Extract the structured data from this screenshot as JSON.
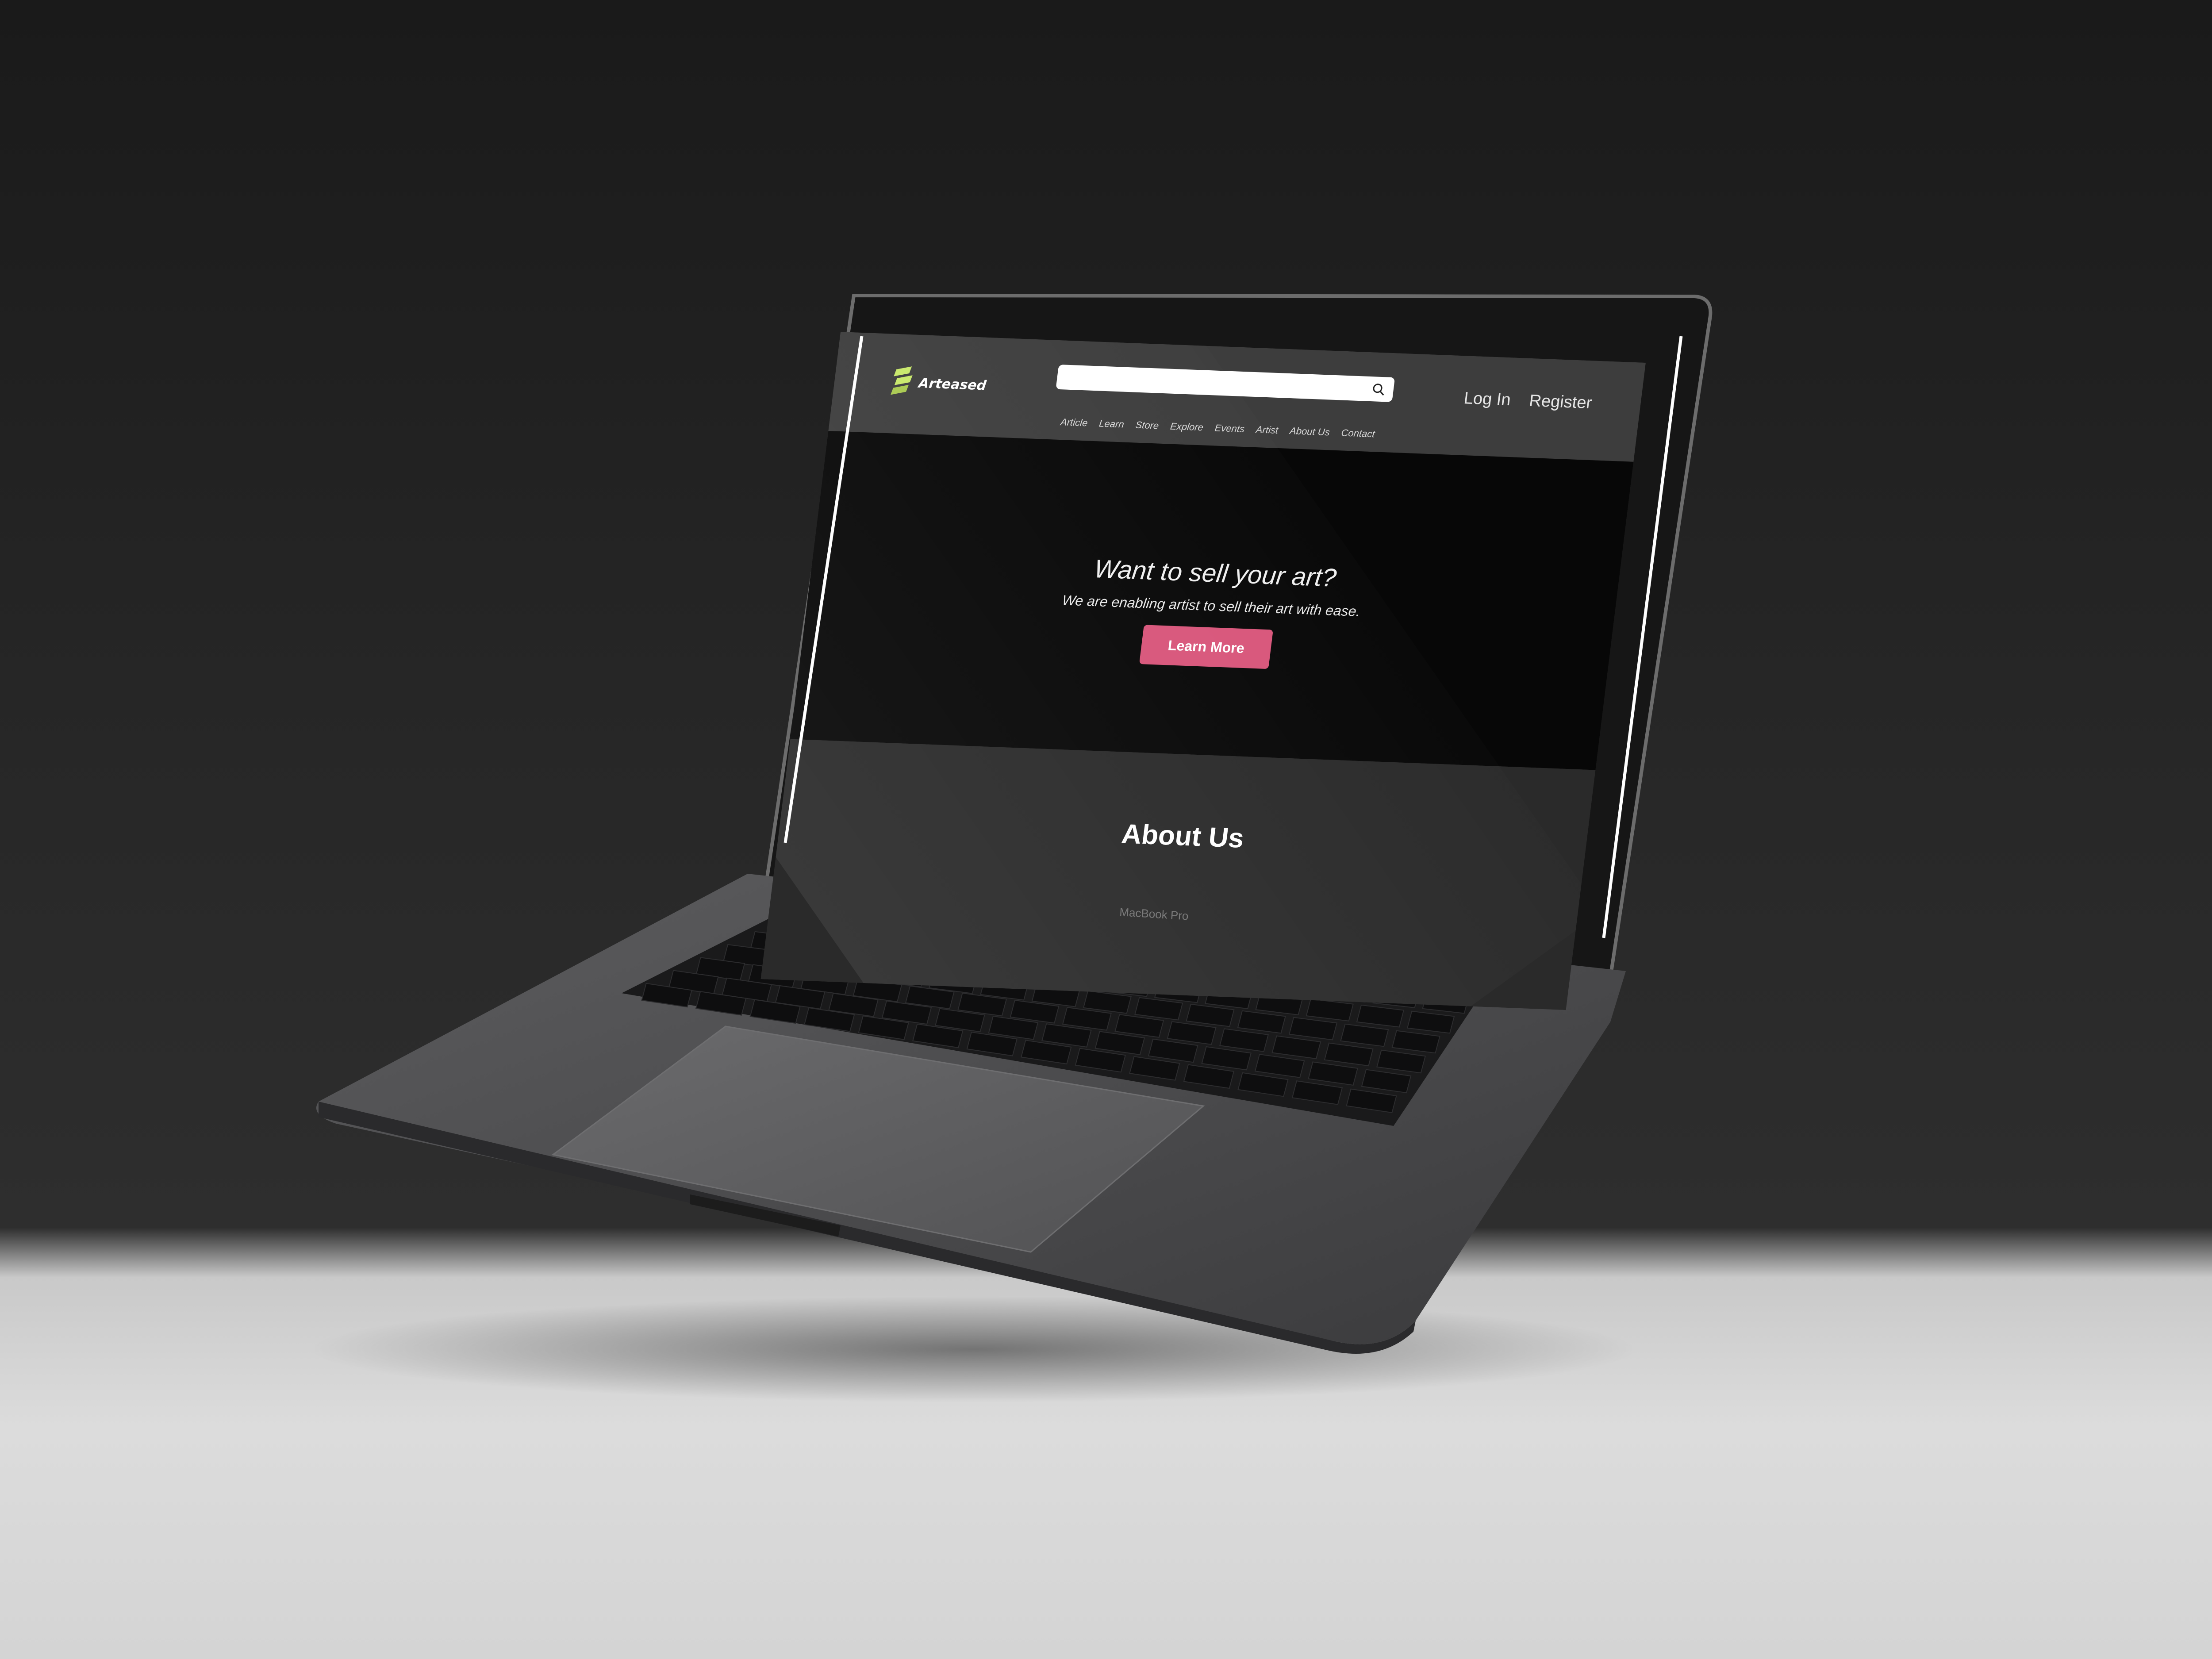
{
  "brand": {
    "name": "Arteased",
    "accent": "#c8e86a"
  },
  "search": {
    "placeholder": ""
  },
  "auth": {
    "login": "Log In",
    "register": "Register"
  },
  "nav": [
    "Article",
    "Learn",
    "Store",
    "Explore",
    "Events",
    "Artist",
    "About Us",
    "Contact"
  ],
  "hero": {
    "title": "Want to sell your art?",
    "subtitle": "We are enabling artist to sell their art with ease.",
    "cta": "Learn More",
    "cta_color": "#d8557a"
  },
  "about": {
    "title": "About Us"
  },
  "device": {
    "label": "MacBook Pro"
  }
}
